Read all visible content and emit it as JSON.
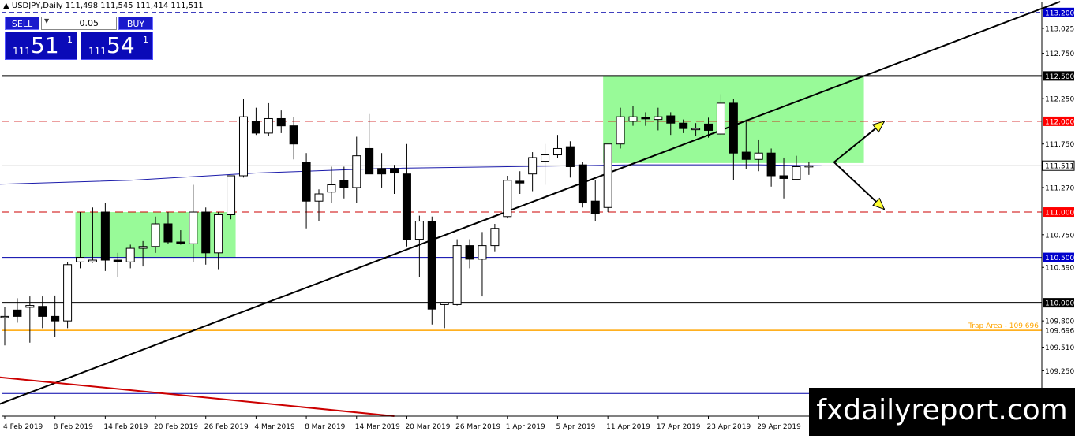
{
  "header": {
    "title": "▲ USDJPY,Daily  111,498 111,545 111,414 111,511"
  },
  "trade_panel": {
    "sell_label": "SELL",
    "buy_label": "BUY",
    "lot_value": "0.05",
    "sell_small": "111",
    "sell_big": "51",
    "sell_sup": "1",
    "buy_small": "111",
    "buy_big": "54",
    "buy_sup": "1"
  },
  "watermark": "fxdailyreport.com",
  "colors": {
    "bull_fill": "#ffffff",
    "bear_fill": "#000000",
    "zone": "#98fa98",
    "resistance_red": "#cc0000",
    "support_blue": "#0000aa",
    "ma_blue": "#1a1aaa",
    "trap_orange": "#ffa500",
    "arrow_yellow": "#ffff33",
    "label_red_bg": "#ff0000",
    "label_blue_bg": "#0000cc"
  },
  "chart_data": {
    "type": "candlestick",
    "symbol": "USDJPY",
    "timeframe": "Daily",
    "ylim": [
      108.75,
      113.32
    ],
    "y_ticks": [
      "113.200",
      "113.025",
      "112.750",
      "112.500",
      "112.250",
      "112.000",
      "111.750",
      "111.511",
      "111.270",
      "111.000",
      "110.750",
      "110.500",
      "110.390",
      "110.000",
      "109.800",
      "109.696",
      "109.510",
      "109.250",
      "109.000"
    ],
    "x_labels": [
      {
        "date": "4 Feb 2019",
        "index": 0
      },
      {
        "date": "8 Feb 2019",
        "index": 4
      },
      {
        "date": "14 Feb 2019",
        "index": 8
      },
      {
        "date": "20 Feb 2019",
        "index": 12
      },
      {
        "date": "26 Feb 2019",
        "index": 16
      },
      {
        "date": "4 Mar 2019",
        "index": 20
      },
      {
        "date": "8 Mar 2019",
        "index": 24
      },
      {
        "date": "14 Mar 2019",
        "index": 28
      },
      {
        "date": "20 Mar 2019",
        "index": 32
      },
      {
        "date": "26 Mar 2019",
        "index": 36
      },
      {
        "date": "1 Apr 2019",
        "index": 40
      },
      {
        "date": "5 Apr 2019",
        "index": 44
      },
      {
        "date": "11 Apr 2019",
        "index": 48
      },
      {
        "date": "17 Apr 2019",
        "index": 52
      },
      {
        "date": "23 Apr 2019",
        "index": 56
      },
      {
        "date": "29 Apr 2019",
        "index": 60
      }
    ],
    "candles": [
      [
        109.85,
        109.95,
        109.53,
        109.85
      ],
      [
        109.92,
        110.05,
        109.78,
        109.85
      ],
      [
        109.95,
        110.07,
        109.56,
        109.97
      ],
      [
        109.96,
        110.07,
        109.72,
        109.85
      ],
      [
        109.85,
        110.08,
        109.62,
        109.8
      ],
      [
        109.8,
        110.45,
        109.72,
        110.42
      ],
      [
        110.45,
        111.0,
        110.38,
        110.5
      ],
      [
        110.45,
        111.05,
        110.44,
        110.47
      ],
      [
        111.0,
        111.1,
        110.35,
        110.47
      ],
      [
        110.47,
        110.55,
        110.28,
        110.45
      ],
      [
        110.45,
        110.64,
        110.38,
        110.6
      ],
      [
        110.6,
        110.68,
        110.4,
        110.62
      ],
      [
        110.62,
        110.95,
        110.55,
        110.87
      ],
      [
        110.87,
        111.0,
        110.65,
        110.67
      ],
      [
        110.67,
        110.8,
        110.64,
        110.65
      ],
      [
        110.65,
        111.3,
        110.45,
        111.0
      ],
      [
        111.0,
        111.05,
        110.42,
        110.55
      ],
      [
        110.55,
        111.0,
        110.37,
        110.97
      ],
      [
        110.97,
        111.4,
        110.92,
        111.4
      ],
      [
        111.4,
        112.25,
        111.38,
        112.05
      ],
      [
        112.0,
        112.15,
        111.85,
        111.87
      ],
      [
        111.87,
        112.2,
        111.84,
        112.03
      ],
      [
        112.03,
        112.12,
        111.87,
        111.95
      ],
      [
        111.95,
        112.05,
        111.58,
        111.75
      ],
      [
        111.55,
        111.65,
        110.82,
        111.12
      ],
      [
        111.12,
        111.25,
        110.9,
        111.2
      ],
      [
        111.22,
        111.5,
        111.1,
        111.3
      ],
      [
        111.35,
        111.5,
        111.15,
        111.27
      ],
      [
        111.27,
        111.83,
        111.1,
        111.62
      ],
      [
        111.7,
        112.08,
        111.45,
        111.42
      ],
      [
        111.48,
        111.65,
        111.27,
        111.42
      ],
      [
        111.48,
        111.52,
        111.2,
        111.43
      ],
      [
        111.42,
        111.75,
        110.62,
        110.7
      ],
      [
        110.7,
        110.96,
        110.28,
        110.9
      ],
      [
        110.9,
        110.95,
        109.76,
        109.93
      ],
      [
        109.98,
        110.0,
        109.72,
        110.0
      ],
      [
        109.98,
        110.7,
        109.97,
        110.63
      ],
      [
        110.63,
        110.7,
        110.38,
        110.48
      ],
      [
        110.48,
        110.78,
        110.07,
        110.63
      ],
      [
        110.63,
        110.87,
        110.56,
        110.82
      ],
      [
        110.95,
        111.4,
        110.93,
        111.35
      ],
      [
        111.34,
        111.45,
        111.2,
        111.32
      ],
      [
        111.42,
        111.66,
        111.23,
        111.6
      ],
      [
        111.56,
        111.75,
        111.3,
        111.63
      ],
      [
        111.63,
        111.85,
        111.6,
        111.7
      ],
      [
        111.72,
        111.78,
        111.38,
        111.5
      ],
      [
        111.52,
        111.55,
        111.05,
        111.1
      ],
      [
        111.12,
        111.35,
        110.9,
        110.98
      ],
      [
        111.05,
        111.75,
        111.0,
        111.75
      ],
      [
        111.75,
        112.15,
        111.7,
        112.05
      ],
      [
        112.0,
        112.17,
        111.95,
        112.05
      ],
      [
        112.04,
        112.1,
        111.95,
        112.03
      ],
      [
        112.02,
        112.15,
        111.9,
        112.05
      ],
      [
        112.06,
        112.1,
        111.85,
        111.98
      ],
      [
        111.98,
        112.02,
        111.87,
        111.92
      ],
      [
        111.92,
        111.98,
        111.84,
        111.92
      ],
      [
        111.97,
        112.04,
        111.82,
        111.9
      ],
      [
        111.86,
        112.3,
        111.85,
        112.2
      ],
      [
        112.2,
        112.25,
        111.35,
        111.65
      ],
      [
        111.66,
        112.02,
        111.47,
        111.58
      ],
      [
        111.58,
        111.8,
        111.45,
        111.65
      ],
      [
        111.65,
        111.7,
        111.28,
        111.4
      ],
      [
        111.4,
        111.6,
        111.15,
        111.37
      ],
      [
        111.36,
        111.62,
        111.36,
        111.5
      ],
      [
        111.5,
        111.55,
        111.41,
        111.51
      ]
    ],
    "levels": [
      {
        "price": 113.2,
        "label": "113.200",
        "style": "dashed-blue"
      },
      {
        "price": 112.5,
        "label": "112.500",
        "style": "solid-black"
      },
      {
        "price": 112.0,
        "label": "112.000",
        "style": "dashed-red"
      },
      {
        "price": 111.511,
        "label": "111.511",
        "style": "current"
      },
      {
        "price": 111.0,
        "label": "111.000",
        "style": "dashed-red"
      },
      {
        "price": 110.5,
        "label": "110.500",
        "style": "solid-blue"
      },
      {
        "price": 110.0,
        "label": "110.000",
        "style": "solid-black"
      },
      {
        "price": 109.696,
        "label": "109.696",
        "style": "orange",
        "annotation": "Trap Area - 109.696"
      },
      {
        "price": 109.0,
        "label": "109.000",
        "style": "solid-blue"
      }
    ],
    "zones": [
      {
        "from_index": 6,
        "to_index": 18,
        "low": 110.5,
        "high": 111.0
      },
      {
        "from_index": 48,
        "to_index": 68,
        "low": 111.54,
        "high": 112.5
      }
    ],
    "trendlines": [
      {
        "from": [
          -2,
          108.8
        ],
        "to": [
          84,
          113.32
        ],
        "color": "#000000",
        "label": "uptrend-line"
      },
      {
        "from": [
          -2,
          109.2
        ],
        "to": [
          31,
          108.75
        ],
        "color": "#cc0000",
        "label": "downtrend-line"
      }
    ],
    "moving_average": [
      [
        -2,
        111.3
      ],
      [
        10,
        111.35
      ],
      [
        20,
        111.43
      ],
      [
        30,
        111.48
      ],
      [
        40,
        111.5
      ],
      [
        50,
        111.52
      ],
      [
        60,
        111.52
      ],
      [
        65,
        111.51
      ]
    ],
    "arrows": [
      {
        "from": [
          66,
          111.55
        ],
        "to": [
          70,
          112.0
        ]
      },
      {
        "from": [
          66,
          111.55
        ],
        "to": [
          70,
          111.03
        ]
      }
    ]
  }
}
